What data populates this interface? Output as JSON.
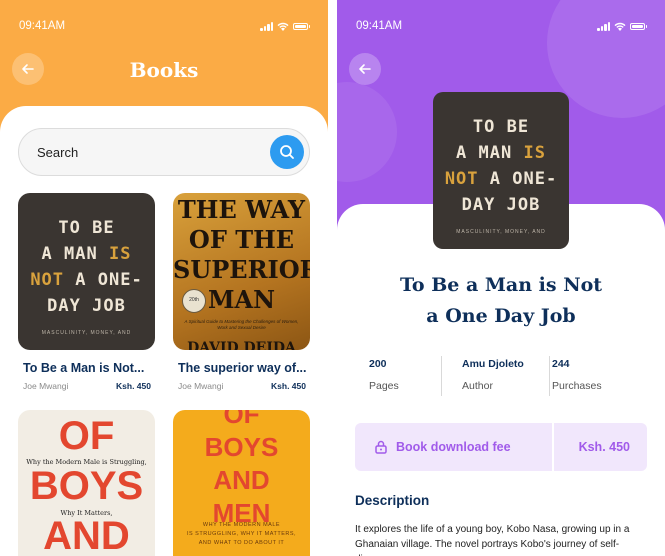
{
  "left_screen": {
    "status": {
      "time": "09:41AM"
    },
    "header": {
      "title": "Books"
    },
    "search": {
      "placeholder": "Search"
    },
    "books": [
      {
        "title": "To Be a Man is Not...",
        "author": "Joe Mwangi",
        "price": "Ksh. 450"
      },
      {
        "title": "The superior way of...",
        "author": "Joe Mwangi",
        "price": "Ksh. 450"
      },
      {
        "title": "",
        "author": "",
        "price": ""
      },
      {
        "title": "",
        "author": "",
        "price": ""
      }
    ],
    "covers": {
      "man": {
        "l1": "TO BE",
        "l2a": "A MAN ",
        "l2b": "IS",
        "l3a": "NOT",
        "l3b": " A ONE-",
        "l4": "DAY JOB",
        "sub": "MASCULINITY, MONEY, AND"
      },
      "superior": {
        "l1": "THE WAY",
        "l2": "OF THE",
        "l3": "SUPERIOR",
        "l4": "MAN",
        "seal": "20th",
        "sub": "A Spiritual Guide to Mastering the Challenges of Women, Work and Sexual Desire",
        "author_peek": "DAVID DEIDA"
      },
      "boys_cream": {
        "big1": "OF",
        "s1": "Why the Modern Male is Struggling,",
        "big2": "BOYS",
        "s2": "Why It Matters,",
        "big3": "AND"
      },
      "boys_yellow": {
        "l0": "OF",
        "l1": "BOYS",
        "l2": "AND",
        "l3": "MEN",
        "sub1": "WHY THE MODERN MALE",
        "sub2": "IS STRUGGLING, WHY IT MATTERS,",
        "sub3": "AND WHAT TO DO ABOUT IT"
      }
    }
  },
  "right_screen": {
    "status": {
      "time": "09:41AM"
    },
    "book": {
      "title_line1": "To Be a Man is Not",
      "title_line2": "a One Day Job"
    },
    "stats": [
      {
        "value": "200",
        "label": "Pages"
      },
      {
        "value": "Amu Djoleto",
        "label": "Author"
      },
      {
        "value": "244",
        "label": "Purchases"
      }
    ],
    "fee": {
      "label": "Book download fee",
      "price": "Ksh. 450"
    },
    "description": {
      "heading": "Description",
      "text": "It explores the life of a young boy, Kobo Nasa, growing up in a Ghanaian village. The novel portrays Kobo's journey of self-discovery..."
    }
  },
  "colors": {
    "orange": "#fbab45",
    "purple": "#a15bea",
    "navy": "#0e2f5a",
    "search_blue": "#2d9bf0"
  }
}
